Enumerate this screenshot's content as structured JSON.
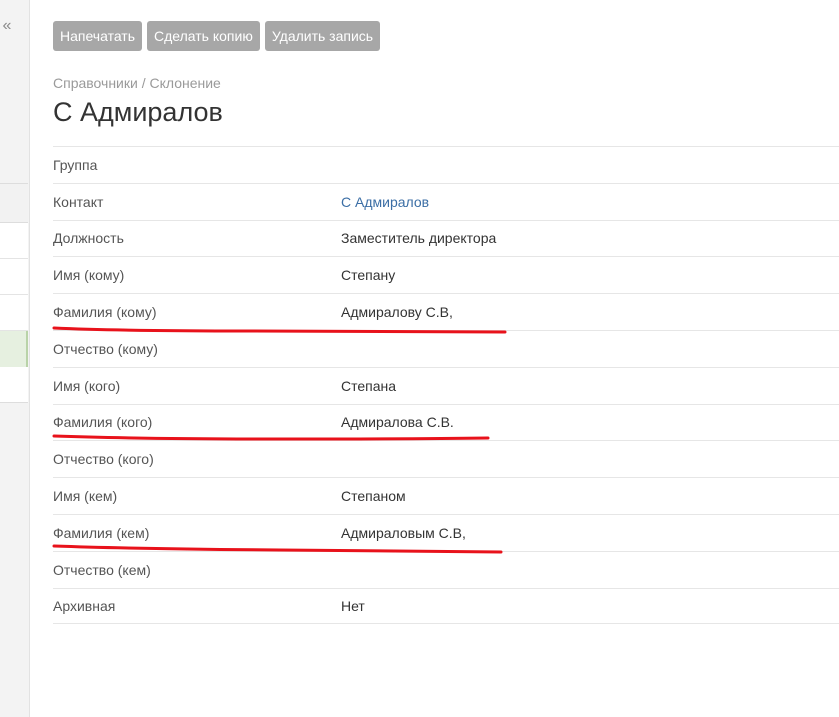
{
  "sidebar": {
    "collapse_glyph": "«"
  },
  "toolbar": {
    "print_label": "Напечатать",
    "copy_label": "Сделать копию",
    "delete_label": "Удалить запись"
  },
  "header": {
    "breadcrumb": "Справочники / Склонение",
    "title": "С Адмиралов"
  },
  "details": {
    "rows": [
      {
        "label": "Группа",
        "value": ""
      },
      {
        "label": "Контакт",
        "value": "С Адмиралов"
      },
      {
        "label": "Должность",
        "value": "Заместитель директора"
      },
      {
        "label": "Имя (кому)",
        "value": "Степану"
      },
      {
        "label": "Фамилия (кому)",
        "value": "Адмиралову С.В,"
      },
      {
        "label": "Отчество (кому)",
        "value": ""
      },
      {
        "label": "Имя (кого)",
        "value": "Степана"
      },
      {
        "label": "Фамилия (кого)",
        "value": "Адмиралова С.В."
      },
      {
        "label": "Отчество (кого)",
        "value": ""
      },
      {
        "label": "Имя (кем)",
        "value": "Степаном"
      },
      {
        "label": "Фамилия (кем)",
        "value": "Адмираловым С.В,"
      },
      {
        "label": "Отчество (кем)",
        "value": ""
      },
      {
        "label": "Архивная",
        "value": "Нет"
      }
    ]
  },
  "colors": {
    "button_bg": "#a7a7a7",
    "link": "#3b6ea5",
    "annotation": "#e8121b"
  }
}
